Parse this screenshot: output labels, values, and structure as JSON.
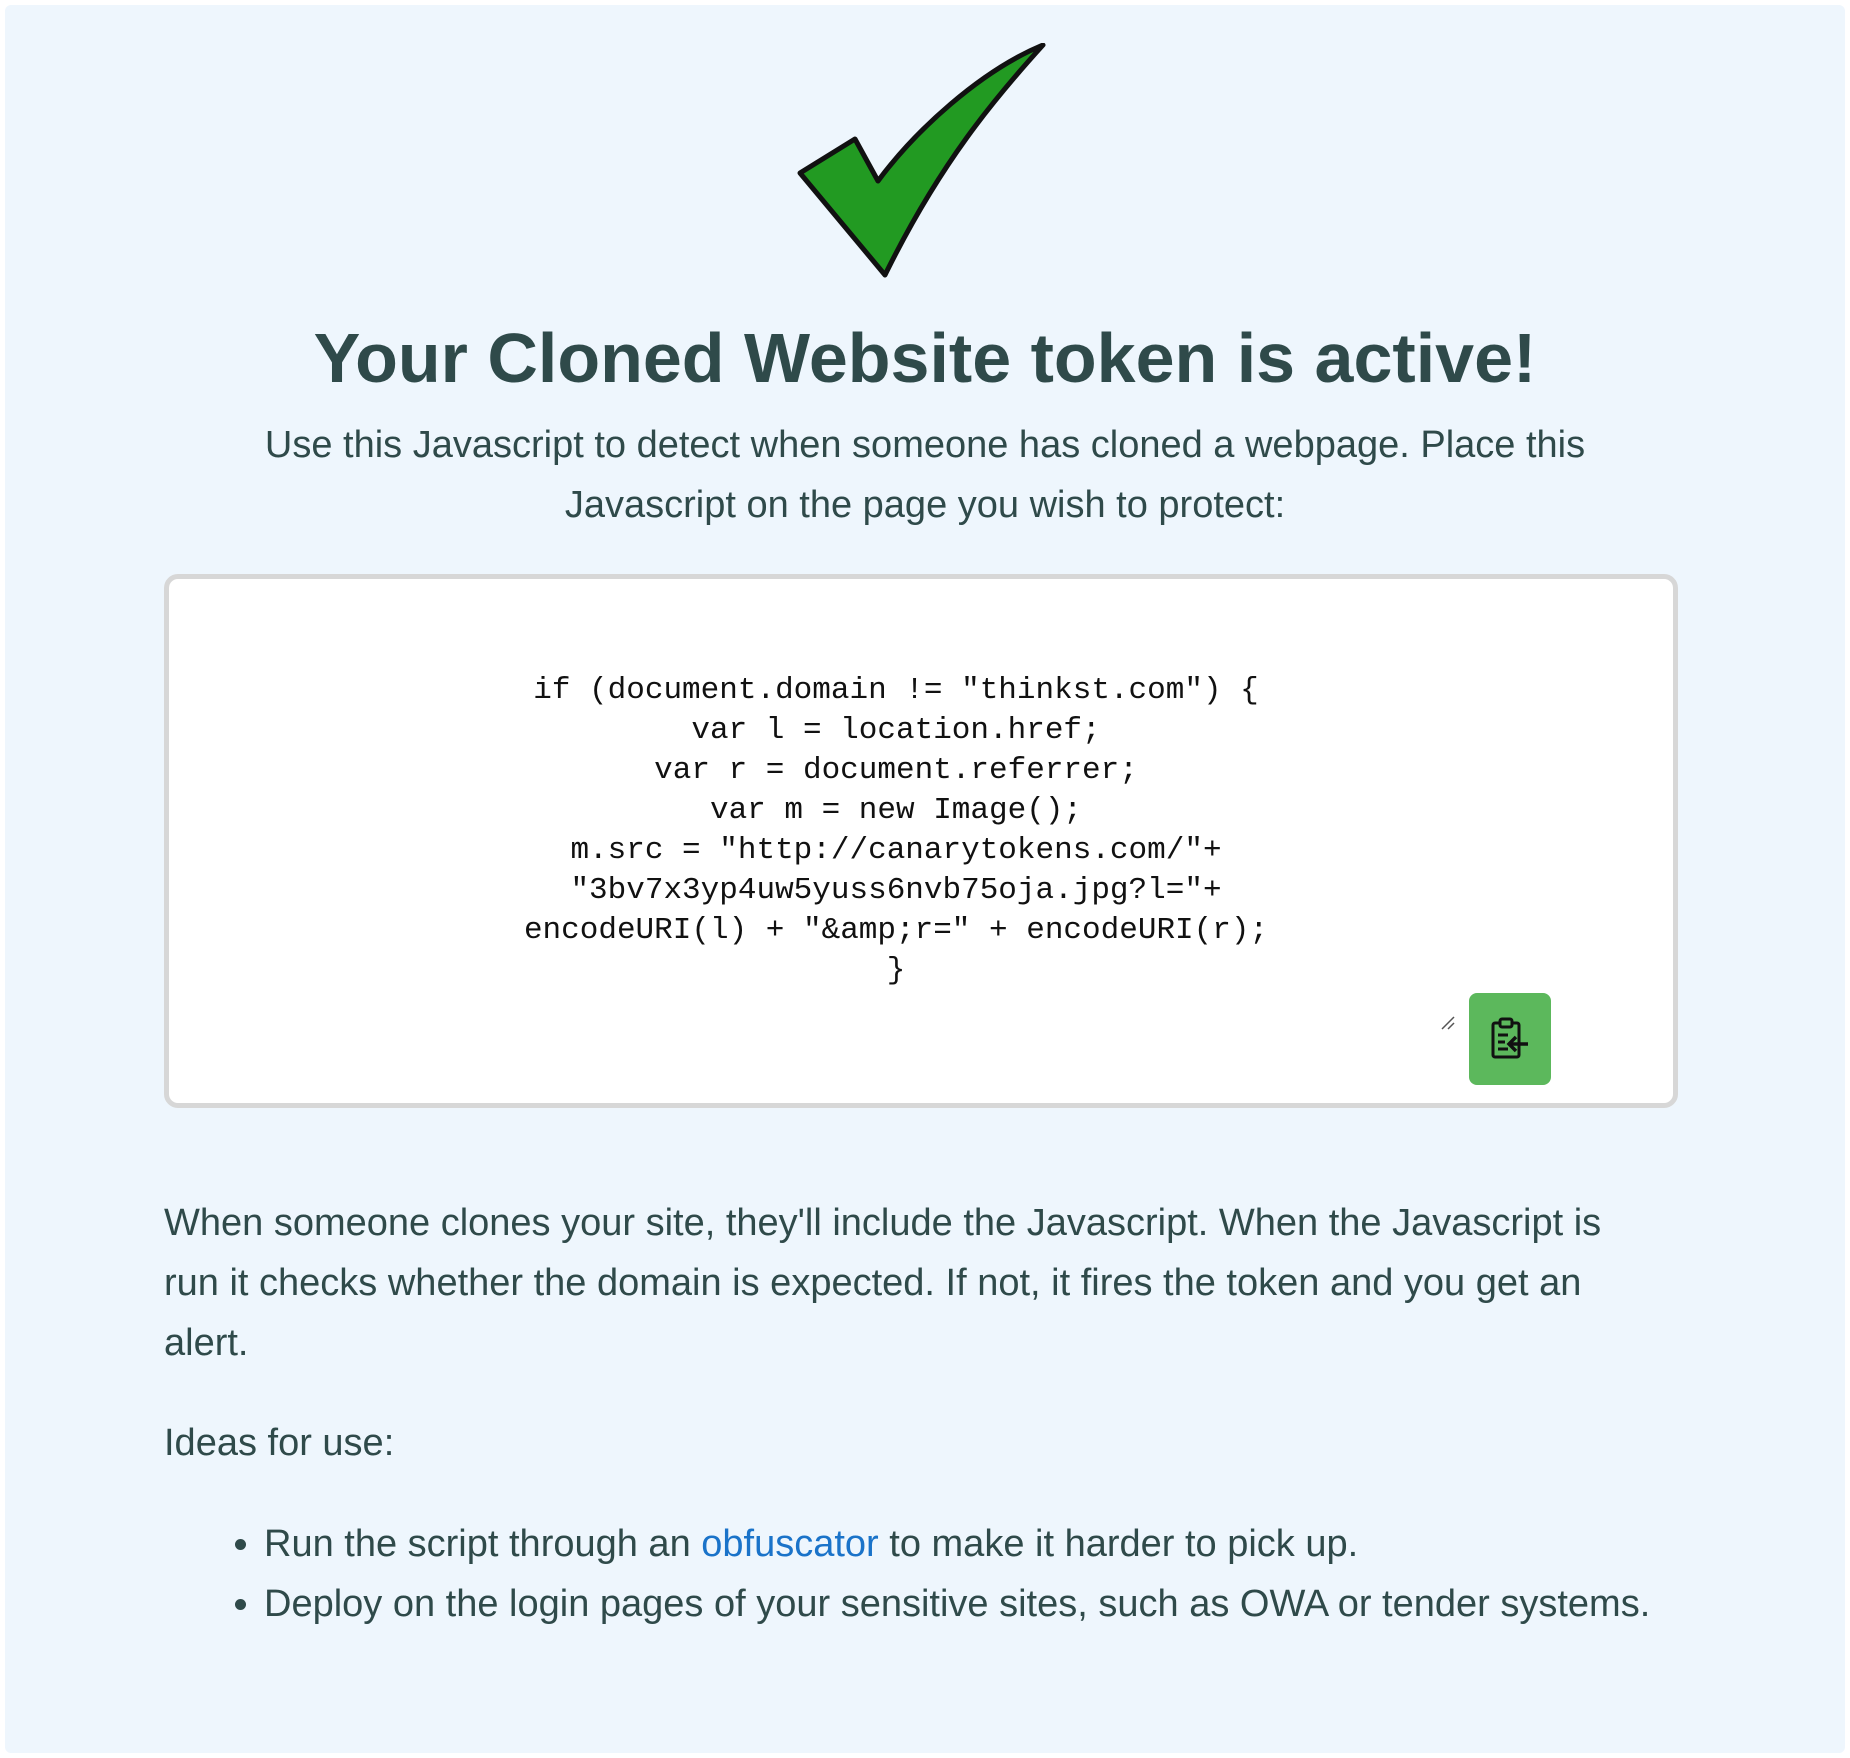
{
  "header": {
    "icon": "checkmark-icon",
    "title": "Your Cloned Website token is active!",
    "subtitle": "Use this Javascript to detect when someone has cloned a webpage. Place this Javascript on the page you wish to protect:"
  },
  "code_box": {
    "code": "if (document.domain != \"thinkst.com\") {\nvar l = location.href;\nvar r = document.referrer;\nvar m = new Image();\nm.src = \"http://canarytokens.com/\"+\n\"3bv7x3yp4uw5yuss6nvb75oja.jpg?l=\"+\nencodeURI(l) + \"&amp;r=\" + encodeURI(r);\n}",
    "copy_button_icon": "clipboard-copy-icon",
    "resize_icon": "resize-handle-icon"
  },
  "description": "When someone clones your site, they'll include the Javascript. When the Javascript is run it checks whether the domain is expected. If not, it fires the token and you get an alert.",
  "ideas": {
    "label": "Ideas for use:",
    "items": [
      {
        "before": "Run the script through an ",
        "link": "obfuscator",
        "after": " to make it harder to pick up."
      },
      {
        "text": "Deploy on the login pages of your sensitive sites, such as OWA or tender systems."
      }
    ]
  },
  "colors": {
    "background": "#eef6fd",
    "text": "#2f4a4a",
    "link": "#1a73c9",
    "copy_button": "#5cb85c",
    "checkmark": "#229a22"
  }
}
